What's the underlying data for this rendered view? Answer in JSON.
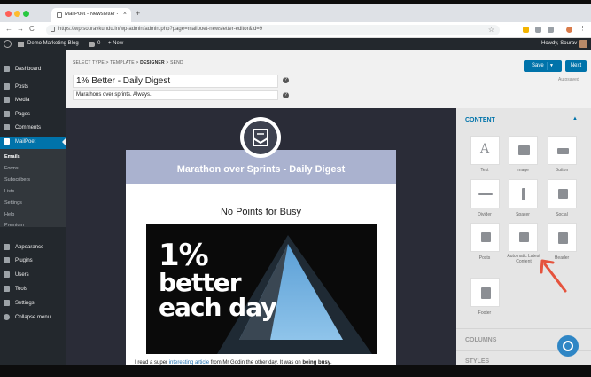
{
  "browser": {
    "tab_title": "MailPoet - Newsletter - Demo",
    "tab_close": "×",
    "new_tab": "+",
    "back": "←",
    "forward": "→",
    "reload": "C",
    "url": "https://wp.souravkundu.in/wp-admin/admin.php?page=mailpoet-newsletter-editor&id=9",
    "star": "☆"
  },
  "adminbar": {
    "site_name": "Demo Marketing Blog",
    "comments_count": "0",
    "new_label": "+ New",
    "howdy": "Howdy, Sourav"
  },
  "sidebar": {
    "items": [
      {
        "label": "Dashboard"
      },
      {
        "label": "Posts"
      },
      {
        "label": "Media"
      },
      {
        "label": "Pages"
      },
      {
        "label": "Comments"
      },
      {
        "label": "MailPoet"
      },
      {
        "label": "Appearance"
      },
      {
        "label": "Plugins"
      },
      {
        "label": "Users"
      },
      {
        "label": "Tools"
      },
      {
        "label": "Settings"
      },
      {
        "label": "Collapse menu"
      }
    ],
    "submenu": [
      "Emails",
      "Forms",
      "Subscribers",
      "Lists",
      "Settings",
      "Help",
      "Premium"
    ]
  },
  "editor": {
    "breadcrumb_pre": "SELECT TYPE > TEMPLATE > ",
    "breadcrumb_current": "DESIGNER",
    "breadcrumb_post": " > SEND",
    "subject": "1% Better - Daily Digest",
    "preheader": "Marathons over sprints. Always.",
    "help": "?",
    "save_label": "Save",
    "save_caret": "▼",
    "next_label": "Next",
    "autosaved": "Autosaved"
  },
  "email": {
    "header_title": "Marathon over Sprints - Daily Digest",
    "heading": "No Points for Busy",
    "hero_lines": [
      "1%",
      "better",
      "each day"
    ],
    "body_pre": "I read a super ",
    "body_link": "interesting article",
    "body_mid": " from Mr Godin the other day. It was on ",
    "body_bold": "being busy",
    "body_end": "."
  },
  "panel": {
    "content_title": "CONTENT",
    "caret": "▲",
    "blocks": [
      {
        "label": "Text",
        "icon": "text-icon"
      },
      {
        "label": "Image",
        "icon": "image-icon"
      },
      {
        "label": "Button",
        "icon": "button-icon"
      },
      {
        "label": "Divider",
        "icon": "divider-icon"
      },
      {
        "label": "Spacer",
        "icon": "spacer-icon"
      },
      {
        "label": "Social",
        "icon": "social-icon"
      },
      {
        "label": "Posts",
        "icon": "posts-icon"
      },
      {
        "label": "Automatic Latest Content",
        "icon": "latest-content-icon"
      },
      {
        "label": "Header",
        "icon": "header-icon"
      },
      {
        "label": "Footer",
        "icon": "footer-icon"
      }
    ],
    "columns_title": "COLUMNS",
    "styles_title": "STYLES"
  },
  "colors": {
    "wp_dark": "#23282d",
    "wp_blue": "#0073aa",
    "email_header": "#aab2cf",
    "arrow": "#e5533d"
  }
}
